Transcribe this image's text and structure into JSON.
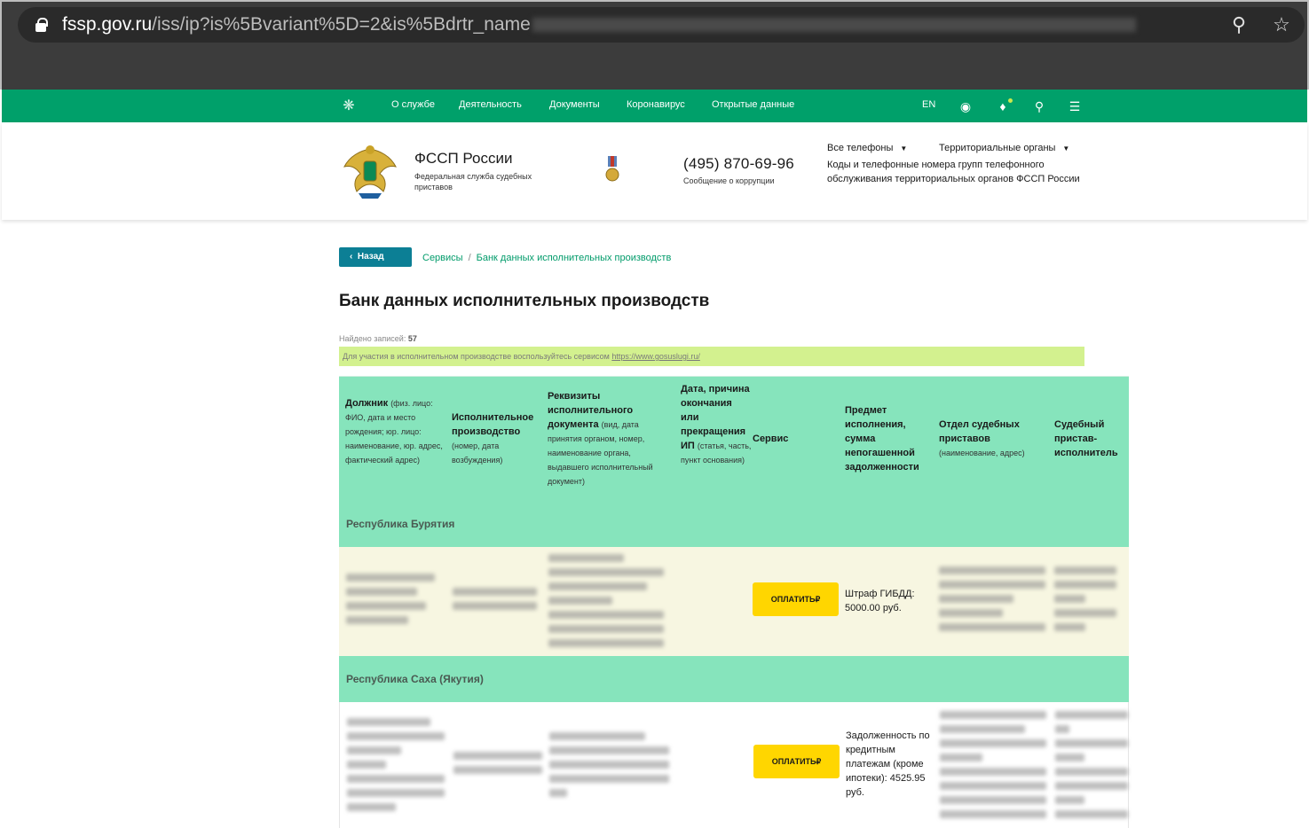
{
  "browser": {
    "url_host": "fssp.gov.ru",
    "url_path": "/iss/ip?is%5Bvariant%5D=2&is%5Bdrtr_name"
  },
  "nav": {
    "items": [
      "О службе",
      "Деятельность",
      "Документы",
      "Коронавирус",
      "Открытые данные"
    ],
    "lang": "EN"
  },
  "header": {
    "org_title": "ФССП России",
    "org_subtitle": "Федеральная служба судебных приставов",
    "phone": "(495) 870-69-96",
    "phone_note": "Сообщение о коррупции",
    "dropdown_phones": "Все телефоны",
    "dropdown_regions": "Территориальные органы",
    "codes_text": "Коды и телефонные номера групп телефонного обслуживания территориальных органов ФССП России"
  },
  "content": {
    "back_label": "Назад",
    "crumb_services": "Сервисы",
    "crumb_sep": "/",
    "crumb_current": "Банк данных исполнительных производств",
    "page_title": "Банк данных исполнительных производств",
    "found_label": "Найдено записей:",
    "found_count": "57",
    "notice_text": "Для участия в исполнительном производстве воспользуйтесь сервисом",
    "notice_link": "https://www.gosuslugi.ru/"
  },
  "table": {
    "headers": [
      {
        "title": "Должник",
        "note": "(физ. лицо: ФИО, дата и место рождения; юр. лицо: наименование, юр. адрес, фактический адрес)"
      },
      {
        "title": "Исполнительное производство",
        "note": "(номер, дата возбуждения)"
      },
      {
        "title": "Реквизиты исполнительного документа",
        "note": "(вид, дата принятия органом, номер, наименование органа, выдавшего исполнительный документ)"
      },
      {
        "title": "Дата, причина окончания или прекращения ИП",
        "note": "(статья, часть, пункт основания)"
      },
      {
        "title": "Сервис",
        "note": ""
      },
      {
        "title": "Предмет исполнения, сумма непогашенной задолженности",
        "note": ""
      },
      {
        "title": "Отдел судебных приставов",
        "note": "(наименование, адрес)"
      },
      {
        "title": "Судебный пристав-исполнитель",
        "note": ""
      }
    ],
    "regions": [
      "Республика Бурятия",
      "Республика Саха (Якутия)"
    ],
    "pay_label": "ОПЛАТИТЬ₽",
    "rows": [
      {
        "subject": "Штраф ГИБДД: 5000.00 руб."
      },
      {
        "subject": "Задолженность по кредитным платежам (кроме ипотеки): 4525.95 руб."
      }
    ]
  }
}
